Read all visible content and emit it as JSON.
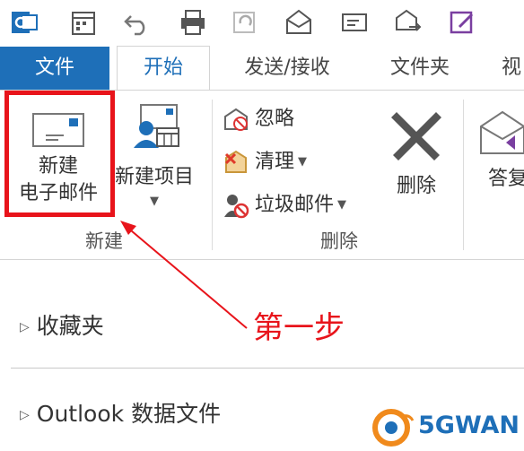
{
  "qat": {
    "icons": [
      "outlook-app-icon",
      "calendar-icon",
      "undo-icon",
      "print-icon",
      "sync-icon",
      "open-mail-icon",
      "message-icon",
      "forward-mail-icon",
      "edit-icon"
    ]
  },
  "tabs": {
    "file": "文件",
    "home": "开始",
    "send_receive": "发送/接收",
    "folder": "文件夹",
    "view_partial": "视"
  },
  "ribbon": {
    "new_group": {
      "new_email_line1": "新建",
      "new_email_line2": "电子邮件",
      "new_items": "新建项目",
      "label": "新建"
    },
    "delete_group": {
      "ignore": "忽略",
      "clean": "清理",
      "junk": "垃圾邮件",
      "delete": "删除",
      "label": "删除"
    },
    "respond_group": {
      "reply_partial": "答复"
    }
  },
  "nav": {
    "favorites": "收藏夹",
    "data_file": "Outlook 数据文件"
  },
  "annotation": {
    "text": "第一步",
    "color": "#e8141b"
  },
  "watermark": {
    "text": "5GWAN"
  },
  "colors": {
    "accent": "#1e6fb8",
    "highlight": "#e8141b"
  }
}
